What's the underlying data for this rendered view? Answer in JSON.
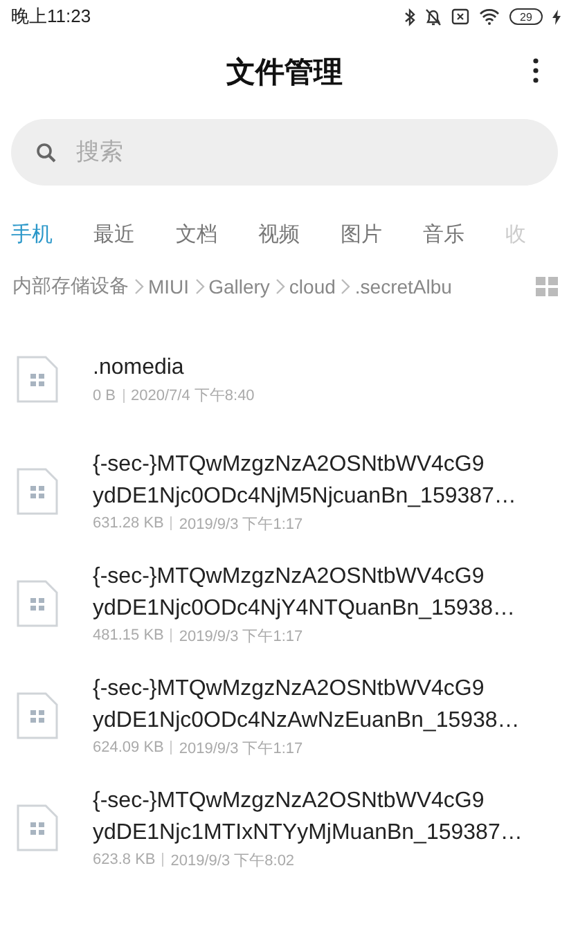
{
  "status_bar": {
    "time": "晚上11:23",
    "battery": "29",
    "charging": true
  },
  "header": {
    "title": "文件管理"
  },
  "search": {
    "placeholder": "搜索"
  },
  "tabs": [
    {
      "label": "手机",
      "selected": true,
      "faded": false
    },
    {
      "label": "最近",
      "selected": false,
      "faded": false
    },
    {
      "label": "文档",
      "selected": false,
      "faded": false
    },
    {
      "label": "视频",
      "selected": false,
      "faded": false
    },
    {
      "label": "图片",
      "selected": false,
      "faded": false
    },
    {
      "label": "音乐",
      "selected": false,
      "faded": false
    },
    {
      "label": "收",
      "selected": false,
      "faded": true
    }
  ],
  "breadcrumb": [
    "内部存储设备",
    "MIUI",
    "Gallery",
    "cloud",
    ".secretAlbu"
  ],
  "files": [
    {
      "name_lines": [
        ".nomedia"
      ],
      "size": "0 B",
      "date": "2020/7/4 下午8:40"
    },
    {
      "name_lines": [
        "{-sec-}MTQwMzgzNzA2OSNtbWV4cG9",
        "ydDE1Njc0ODc4NjM5NjcuanBn_159387…"
      ],
      "size": "631.28 KB",
      "date": "2019/9/3 下午1:17"
    },
    {
      "name_lines": [
        "{-sec-}MTQwMzgzNzA2OSNtbWV4cG9",
        "ydDE1Njc0ODc4NjY4NTQuanBn_15938…"
      ],
      "size": "481.15 KB",
      "date": "2019/9/3 下午1:17"
    },
    {
      "name_lines": [
        "{-sec-}MTQwMzgzNzA2OSNtbWV4cG9",
        "ydDE1Njc0ODc4NzAwNzEuanBn_15938…"
      ],
      "size": "624.09 KB",
      "date": "2019/9/3 下午1:17"
    },
    {
      "name_lines": [
        "{-sec-}MTQwMzgzNzA2OSNtbWV4cG9",
        "ydDE1Njc1MTIxNTYyMjMuanBn_159387…"
      ],
      "size": "623.8 KB",
      "date": "2019/9/3 下午8:02"
    }
  ]
}
